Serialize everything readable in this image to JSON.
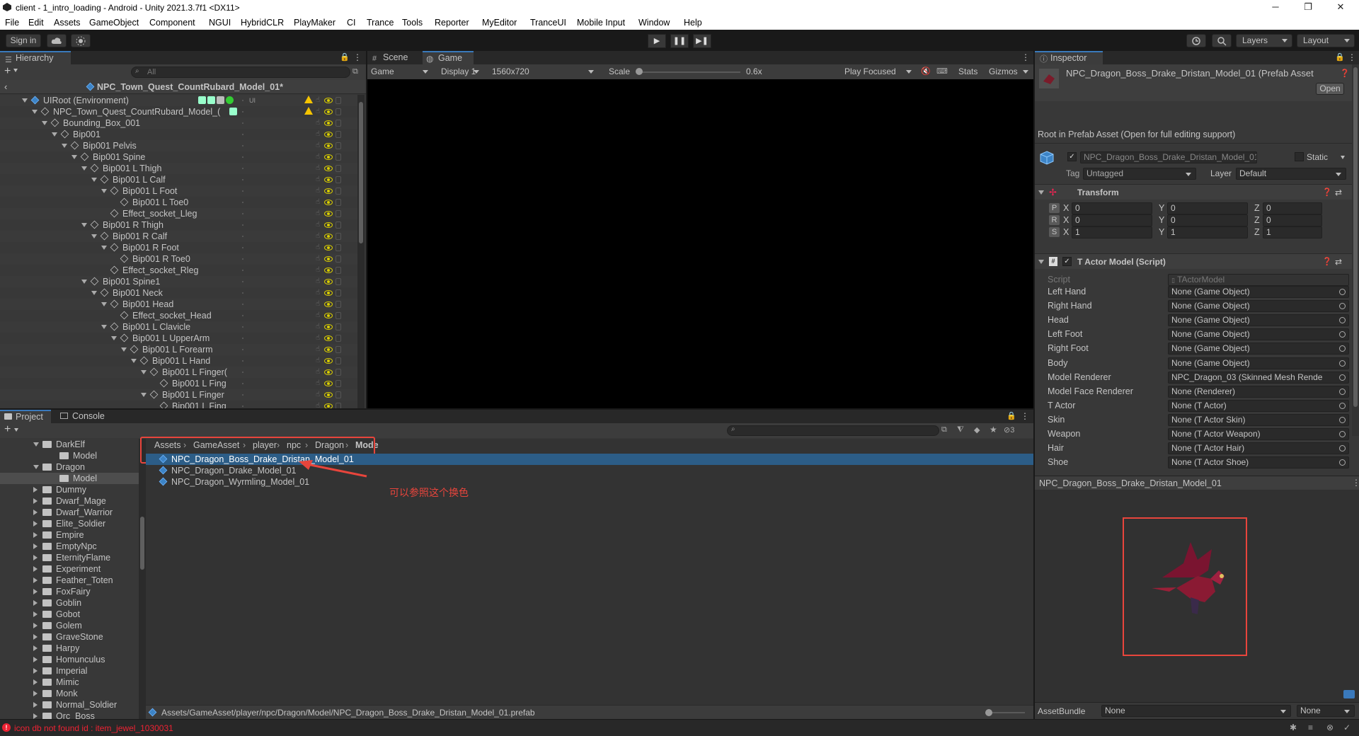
{
  "window": {
    "title": "client - 1_intro_loading - Android - Unity 2021.3.7f1 <DX11>",
    "min": "─",
    "max": "❐",
    "close": "✕"
  },
  "menu": [
    "File",
    "Edit",
    "Assets",
    "GameObject",
    "Component",
    "NGUI",
    "HybridCLR",
    "PlayMaker",
    "CI",
    "Trance",
    "Tools",
    "Reporter",
    "MyEditor",
    "TranceUI",
    "Mobile Input",
    "Window",
    "Help"
  ],
  "toolbar": {
    "signin": "Sign in",
    "layers": "Layers",
    "layout": "Layout"
  },
  "hierarchy": {
    "tab": "Hierarchy",
    "search_placeholder": "All",
    "prefab_title": "NPC_Town_Quest_CountRubard_Model_01*",
    "items": [
      {
        "t": "UIRoot (Environment)",
        "d": 0,
        "e": "o",
        "tag": "UI"
      },
      {
        "t": "NPC_Town_Quest_CountRubard_Model_(",
        "d": 1,
        "e": "o"
      },
      {
        "t": "Bounding_Box_001",
        "d": 2,
        "e": "o"
      },
      {
        "t": "Bip001",
        "d": 3,
        "e": "o"
      },
      {
        "t": "Bip001 Pelvis",
        "d": 4,
        "e": "o"
      },
      {
        "t": "Bip001 Spine",
        "d": 5,
        "e": "o"
      },
      {
        "t": "Bip001 L Thigh",
        "d": 6,
        "e": "o"
      },
      {
        "t": "Bip001 L Calf",
        "d": 7,
        "e": "o"
      },
      {
        "t": "Bip001 L Foot",
        "d": 8,
        "e": "o"
      },
      {
        "t": "Bip001 L Toe0",
        "d": 9,
        "e": "n"
      },
      {
        "t": "Effect_socket_Lleg",
        "d": 8,
        "e": "n"
      },
      {
        "t": "Bip001 R Thigh",
        "d": 6,
        "e": "o"
      },
      {
        "t": "Bip001 R Calf",
        "d": 7,
        "e": "o"
      },
      {
        "t": "Bip001 R Foot",
        "d": 8,
        "e": "o"
      },
      {
        "t": "Bip001 R Toe0",
        "d": 9,
        "e": "n"
      },
      {
        "t": "Effect_socket_Rleg",
        "d": 8,
        "e": "n"
      },
      {
        "t": "Bip001 Spine1",
        "d": 6,
        "e": "o"
      },
      {
        "t": "Bip001 Neck",
        "d": 7,
        "e": "o"
      },
      {
        "t": "Bip001 Head",
        "d": 8,
        "e": "o"
      },
      {
        "t": "Effect_socket_Head",
        "d": 9,
        "e": "n"
      },
      {
        "t": "Bip001 L Clavicle",
        "d": 8,
        "e": "o"
      },
      {
        "t": "Bip001 L UpperArm",
        "d": 9,
        "e": "o"
      },
      {
        "t": "Bip001 L Forearm",
        "d": 10,
        "e": "o"
      },
      {
        "t": "Bip001 L Hand",
        "d": 11,
        "e": "o"
      },
      {
        "t": "Bip001 L Finger(",
        "d": 12,
        "e": "o"
      },
      {
        "t": "Bip001 L Fing",
        "d": 13,
        "e": "n"
      },
      {
        "t": "Bip001 L Finger",
        "d": 12,
        "e": "o"
      },
      {
        "t": "Bip001 L Fing",
        "d": 13,
        "e": "n"
      }
    ]
  },
  "scene": {
    "tab_scene": "Scene",
    "tab_game": "Game",
    "game": "Game",
    "display": "Display 1",
    "resolution": "1560x720",
    "scale_label": "Scale",
    "scale_value": "0.6x",
    "scale_fill": 0.0,
    "play_focused": "Play Focused",
    "stats": "Stats",
    "gizmos": "Gizmos"
  },
  "project": {
    "tab_project": "Project",
    "tab_console": "Console",
    "hidden_count": "3",
    "folders": [
      {
        "t": "DarkElf",
        "d": 0,
        "e": "o"
      },
      {
        "t": "Model",
        "d": 1,
        "e": "n"
      },
      {
        "t": "Dragon",
        "d": 0,
        "e": "o"
      },
      {
        "t": "Model",
        "d": 1,
        "e": "n",
        "sel": true
      },
      {
        "t": "Dummy",
        "d": 0,
        "e": "c"
      },
      {
        "t": "Dwarf_Mage",
        "d": 0,
        "e": "c"
      },
      {
        "t": "Dwarf_Warrior",
        "d": 0,
        "e": "c"
      },
      {
        "t": "Elite_Soldier",
        "d": 0,
        "e": "c"
      },
      {
        "t": "Empire",
        "d": 0,
        "e": "c"
      },
      {
        "t": "EmptyNpc",
        "d": 0,
        "e": "c"
      },
      {
        "t": "EternityFlame",
        "d": 0,
        "e": "c"
      },
      {
        "t": "Experiment",
        "d": 0,
        "e": "c"
      },
      {
        "t": "Feather_Toten",
        "d": 0,
        "e": "c"
      },
      {
        "t": "FoxFairy",
        "d": 0,
        "e": "c"
      },
      {
        "t": "Goblin",
        "d": 0,
        "e": "c"
      },
      {
        "t": "Gobot",
        "d": 0,
        "e": "c"
      },
      {
        "t": "Golem",
        "d": 0,
        "e": "c"
      },
      {
        "t": "GraveStone",
        "d": 0,
        "e": "c"
      },
      {
        "t": "Harpy",
        "d": 0,
        "e": "c"
      },
      {
        "t": "Homunculus",
        "d": 0,
        "e": "c"
      },
      {
        "t": "Imperial",
        "d": 0,
        "e": "c"
      },
      {
        "t": "Mimic",
        "d": 0,
        "e": "c"
      },
      {
        "t": "Monk",
        "d": 0,
        "e": "c"
      },
      {
        "t": "Normal_Soldier",
        "d": 0,
        "e": "c"
      },
      {
        "t": "Orc_Boss",
        "d": 0,
        "e": "c"
      }
    ],
    "breadcrumb": [
      "Assets",
      "GameAsset",
      "player",
      "npc",
      "Dragon",
      "Mode"
    ],
    "files": [
      "NPC_Dragon_Boss_Drake_Dristan_Model_01",
      "NPC_Dragon_Drake_Model_01",
      "NPC_Dragon_Wyrmling_Model_01"
    ],
    "annotation": "可以参照这个换色",
    "status_path": "Assets/GameAsset/player/npc/Dragon/Model/NPC_Dragon_Boss_Drake_Dristan_Model_01.prefab"
  },
  "inspector": {
    "tab": "Inspector",
    "title": "NPC_Dragon_Boss_Drake_Dristan_Model_01 (Prefab Asset",
    "open": "Open",
    "root_note": "Root in Prefab Asset (Open for full editing support)",
    "name": "NPC_Dragon_Boss_Drake_Dristan_Model_01",
    "static": "Static",
    "tag_label": "Tag",
    "tag": "Untagged",
    "layer_label": "Layer",
    "layer": "Default",
    "transform": {
      "title": "Transform",
      "rows": [
        {
          "k": "P",
          "x": "0",
          "y": "0",
          "z": "0"
        },
        {
          "k": "R",
          "x": "0",
          "y": "0",
          "z": "0"
        },
        {
          "k": "S",
          "x": "1",
          "y": "1",
          "z": "1"
        }
      ]
    },
    "script": {
      "title": "T Actor Model (Script)",
      "script_label": "Script",
      "script_value": "TActorModel",
      "props": [
        {
          "k": "Left Hand",
          "v": "None (Game Object)"
        },
        {
          "k": "Right Hand",
          "v": "None (Game Object)"
        },
        {
          "k": "Head",
          "v": "None (Game Object)"
        },
        {
          "k": "Left Foot",
          "v": "None (Game Object)"
        },
        {
          "k": "Right Foot",
          "v": "None (Game Object)"
        },
        {
          "k": "Body",
          "v": "None (Game Object)"
        },
        {
          "k": "Model Renderer",
          "v": "NPC_Dragon_03 (Skinned Mesh Rende"
        },
        {
          "k": "Model Face Renderer",
          "v": "None (Renderer)"
        },
        {
          "k": "T Actor",
          "v": "None (T Actor)"
        },
        {
          "k": "Skin",
          "v": "None (T Actor Skin)"
        },
        {
          "k": "Weapon",
          "v": "None (T Actor Weapon)"
        },
        {
          "k": "Hair",
          "v": "None (T Actor Hair)"
        },
        {
          "k": "Shoe",
          "v": "None (T Actor Shoe)"
        }
      ]
    },
    "preview_title": "NPC_Dragon_Boss_Drake_Dristan_Model_01",
    "assetbundle_label": "AssetBundle",
    "assetbundle": "None",
    "assetbundle_variant": "None"
  },
  "status": {
    "error": "icon db not found id : item_jewel_1030031"
  },
  "colors": {
    "accent": "#3a79bb",
    "selection": "#2c5d87",
    "annotation": "#e8453c",
    "warning": "#f5c400"
  }
}
